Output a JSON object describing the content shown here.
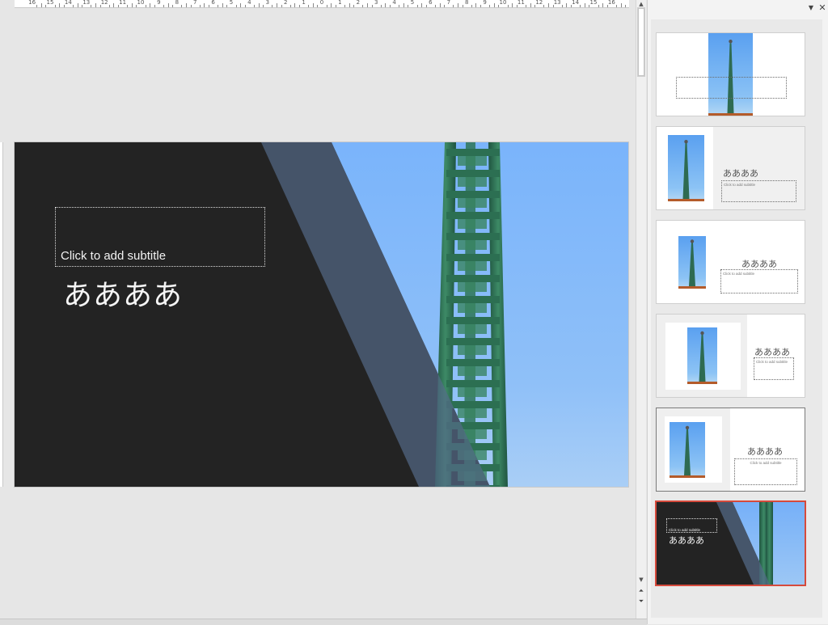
{
  "ruler": {
    "labels": [
      "16",
      "15",
      "14",
      "13",
      "12",
      "11",
      "10",
      "9",
      "8",
      "7",
      "6",
      "5",
      "4",
      "3",
      "2",
      "1",
      "0",
      "1",
      "2",
      "3",
      "4",
      "5",
      "6",
      "7",
      "8",
      "9",
      "10",
      "11",
      "12",
      "13",
      "14",
      "15",
      "16"
    ]
  },
  "slide": {
    "subtitle_placeholder": "Click to add subtitle",
    "title": "ああああ",
    "colors": {
      "background": "#232323",
      "band": "#566c8a",
      "sky": "#7ab4fb",
      "tower": "#2e6b52"
    }
  },
  "pane": {
    "dropdown_icon": "chevron-down-icon",
    "close_icon": "close-icon",
    "layouts": [
      {
        "title": "",
        "subtitle": ""
      },
      {
        "title": "ああああ",
        "subtitle": "Click to add subtitle"
      },
      {
        "title": "ああああ",
        "subtitle": "Click to add subtitle"
      },
      {
        "title": "ああああ",
        "subtitle": "Click to add subtitle"
      },
      {
        "title": "ああああ",
        "subtitle": "Click to add subtitle"
      },
      {
        "title": "ああああ",
        "subtitle": "Click to add subtitle"
      }
    ],
    "selected_index": 5,
    "accent": "#d64a3c"
  },
  "scrollbar": {
    "up_icon": "scroll-up-icon",
    "down_icon": "scroll-down-icon",
    "prev_slide_icon": "previous-slide-icon",
    "next_slide_icon": "next-slide-icon"
  }
}
